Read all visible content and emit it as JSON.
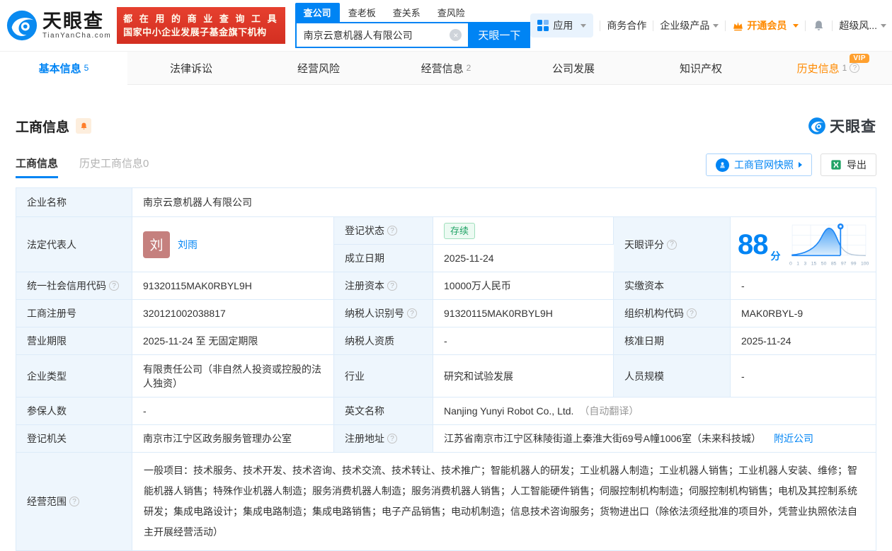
{
  "icons": {
    "help": "?",
    "clear": "×"
  },
  "header": {
    "logo": {
      "title": "天眼查",
      "subtitle": "TianYanCha.com"
    },
    "slogan_line1": "都 在 用 的 商 业 查 询 工 具",
    "slogan_line2": "国家中小企业发展子基金旗下机构",
    "search": {
      "tabs": [
        {
          "label": "查公司"
        },
        {
          "label": "查老板"
        },
        {
          "label": "查关系"
        },
        {
          "label": "查风险"
        }
      ],
      "value": "南京云意机器人有限公司",
      "button": "天眼一下"
    },
    "nav": {
      "apps": "应用",
      "cooperation": "商务合作",
      "enterprise": "企业级产品",
      "vip": "开通会员",
      "risk": "超级风..."
    }
  },
  "tabs": [
    {
      "label": "基本信息",
      "count": "5"
    },
    {
      "label": "法律诉讼"
    },
    {
      "label": "经营风险"
    },
    {
      "label": "经营信息",
      "count": "2"
    },
    {
      "label": "公司发展"
    },
    {
      "label": "知识产权"
    },
    {
      "label": "历史信息",
      "count": "1",
      "badge": "VIP"
    }
  ],
  "section": {
    "title": "工商信息",
    "subtabs": [
      {
        "label": "工商信息"
      },
      {
        "label": "历史工商信息0"
      }
    ],
    "snapshot_button": "工商官网快照",
    "export_button": "导出",
    "watermark": "天眼查"
  },
  "table": {
    "company_name": {
      "label": "企业名称",
      "value": "南京云意机器人有限公司"
    },
    "legal_rep": {
      "label": "法定代表人",
      "avatar": "刘",
      "name": "刘雨"
    },
    "reg_status": {
      "label": "登记状态",
      "value": "存续"
    },
    "establish_date": {
      "label": "成立日期",
      "value": "2025-11-24"
    },
    "score": {
      "label": "天眼评分",
      "value": "88",
      "unit": "分",
      "axis": [
        "0",
        "1",
        "3",
        "15",
        "50",
        "85",
        "97",
        "99",
        "100"
      ]
    },
    "credit_code": {
      "label": "统一社会信用代码",
      "value": "91320115MAK0RBYL9H"
    },
    "reg_capital": {
      "label": "注册资本",
      "value": "10000万人民币"
    },
    "paid_capital": {
      "label": "实缴资本",
      "value": "-"
    },
    "reg_number": {
      "label": "工商注册号",
      "value": "320121002038817"
    },
    "taxpayer_id": {
      "label": "纳税人识别号",
      "value": "91320115MAK0RBYL9H"
    },
    "org_code": {
      "label": "组织机构代码",
      "value": "MAK0RBYL-9"
    },
    "business_term": {
      "label": "营业期限",
      "value": "2025-11-24 至 无固定期限"
    },
    "taxpayer_quality": {
      "label": "纳税人资质",
      "value": "-"
    },
    "approval_date": {
      "label": "核准日期",
      "value": "2025-11-24"
    },
    "company_type": {
      "label": "企业类型",
      "value": "有限责任公司（非自然人投资或控股的法人独资）"
    },
    "industry": {
      "label": "行业",
      "value": "研究和试验发展"
    },
    "staff_size": {
      "label": "人员规模",
      "value": "-"
    },
    "insured_count": {
      "label": "参保人数",
      "value": "-"
    },
    "english_name": {
      "label": "英文名称",
      "value": "Nanjing Yunyi Robot Co., Ltd.",
      "note": "（自动翻译）"
    },
    "reg_authority": {
      "label": "登记机关",
      "value": "南京市江宁区政务服务管理办公室"
    },
    "reg_address": {
      "label": "注册地址",
      "value": "江苏省南京市江宁区秣陵街道上秦淮大街69号A幢1006室（未来科技城）",
      "link": "附近公司"
    },
    "business_scope": {
      "label": "经营范围",
      "value": "一般项目：技术服务、技术开发、技术咨询、技术交流、技术转让、技术推广；智能机器人的研发；工业机器人制造；工业机器人销售；工业机器人安装、维修；智能机器人销售；特殊作业机器人制造；服务消费机器人制造；服务消费机器人销售；人工智能硬件销售；伺服控制机构制造；伺服控制机构销售；电机及其控制系统研发；集成电路设计；集成电路制造；集成电路销售；电子产品销售；电动机制造；信息技术咨询服务；货物进出口（除依法须经批准的项目外，凭营业执照依法自主开展经营活动）"
    }
  }
}
